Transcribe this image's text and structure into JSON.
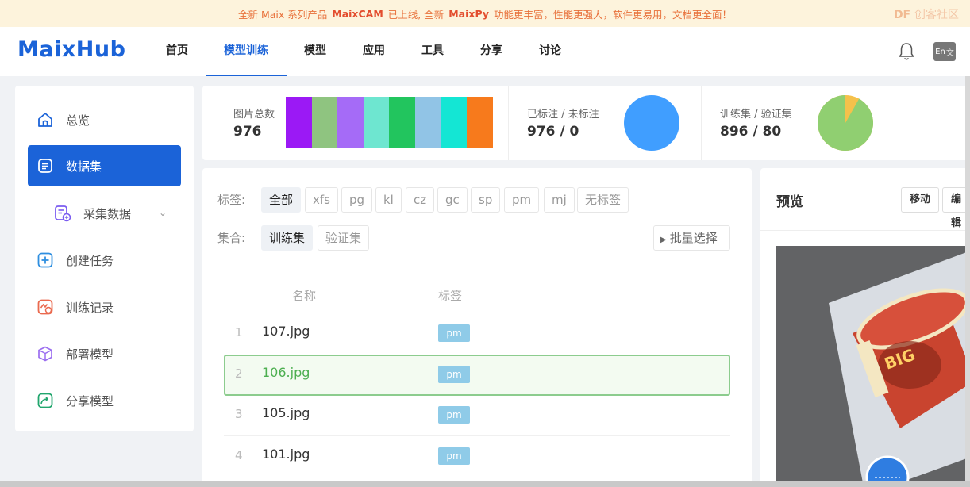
{
  "banner": {
    "prefix": "全新 Maix 系列产品",
    "product": "MaixCAM",
    "mid": "已上线, 全新",
    "product2": "MaixPy",
    "suffix": "功能更丰富，性能更强大，软件更易用，文档更全面！",
    "watermark_brand": "DF",
    "watermark_text": "创客社区"
  },
  "nav": {
    "logo": "MaixHub",
    "items": [
      "首页",
      "模型训练",
      "模型",
      "应用",
      "工具",
      "分享",
      "讨论"
    ],
    "active": "模型训练",
    "lang_label": "En"
  },
  "sidebar": {
    "items": [
      {
        "label": "总览",
        "icon": "home-icon"
      },
      {
        "label": "数据集",
        "icon": "dataset-icon"
      },
      {
        "label": "采集数据",
        "icon": "collect-icon"
      },
      {
        "label": "创建任务",
        "icon": "plus-box-icon"
      },
      {
        "label": "训练记录",
        "icon": "history-icon"
      },
      {
        "label": "部署模型",
        "icon": "cube-icon"
      },
      {
        "label": "分享模型",
        "icon": "share-icon"
      }
    ],
    "active": "数据集"
  },
  "stats": {
    "total_label": "图片总数",
    "total_value": "976",
    "labeled_label": "已标注 / 未标注",
    "labeled_value": "976 / 0",
    "split_label": "训练集 / 验证集",
    "split_value": "896 / 80",
    "class_colors": [
      "#9b19f5",
      "#8fc480",
      "#a56bf7",
      "#6ee6d0",
      "#22c55e",
      "#91c4e6",
      "#14e6d4",
      "#f77a1c"
    ],
    "labeled_fraction": 1.0,
    "train_fraction": 0.918,
    "pie_colors": {
      "labeled": "#409eff",
      "train": "#90cf71",
      "val": "#f5c14b"
    }
  },
  "filters": {
    "tag_label": "标签:",
    "tags": [
      "全部",
      "xfs",
      "pg",
      "kl",
      "cz",
      "gc",
      "sp",
      "pm",
      "mj",
      "无标签"
    ],
    "tag_active": "全部",
    "set_label": "集合:",
    "sets": [
      "训练集",
      "验证集"
    ],
    "set_active": "训练集",
    "batch_select": "批量选择"
  },
  "table": {
    "headers": [
      "名称",
      "标签"
    ],
    "rows": [
      {
        "index": "1",
        "name": "107.jpg",
        "tag": "pm"
      },
      {
        "index": "2",
        "name": "106.jpg",
        "tag": "pm"
      },
      {
        "index": "3",
        "name": "105.jpg",
        "tag": "pm"
      },
      {
        "index": "4",
        "name": "101.jpg",
        "tag": "pm"
      }
    ],
    "selected_index": "2"
  },
  "preview": {
    "title": "预览",
    "move": "移动",
    "edit": "编辑"
  }
}
